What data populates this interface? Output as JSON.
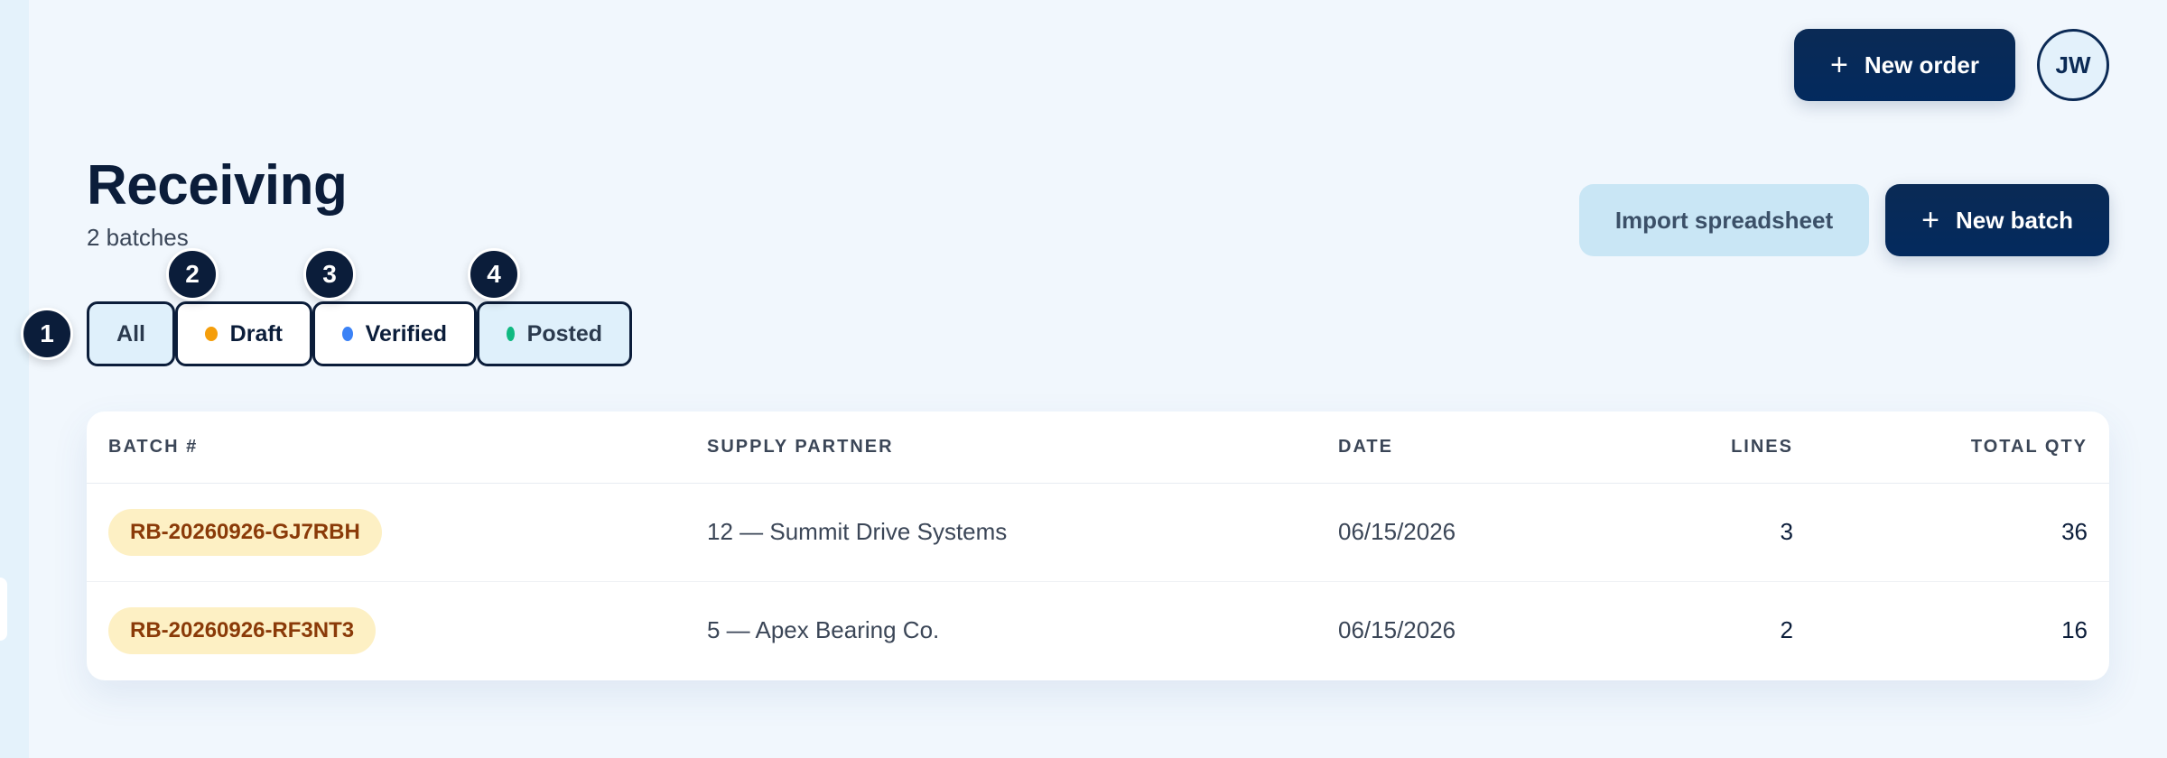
{
  "topbar": {
    "new_order_label": "New order",
    "avatar_initials": "JW"
  },
  "page": {
    "title": "Receiving",
    "subtitle": "2 batches"
  },
  "actions": {
    "import_label": "Import spreadsheet",
    "new_batch_label": "New batch"
  },
  "filters": [
    {
      "label": "All",
      "badge": "1"
    },
    {
      "label": "Draft",
      "badge": "2",
      "dot_color": "#f59e0b"
    },
    {
      "label": "Verified",
      "badge": "3",
      "dot_color": "#3b82f6"
    },
    {
      "label": "Posted",
      "badge": "4",
      "dot_color": "#10b981"
    }
  ],
  "table": {
    "headers": [
      "BATCH #",
      "SUPPLY PARTNER",
      "DATE",
      "LINES",
      "TOTAL QTY"
    ],
    "rows": [
      {
        "batch": "RB-20260926-GJ7RBH",
        "partner": "12 — Summit Drive Systems",
        "date": "06/15/2026",
        "lines": "3",
        "qty": "36"
      },
      {
        "batch": "RB-20260926-RF3NT3",
        "partner": "5 — Apex Bearing Co.",
        "date": "06/15/2026",
        "lines": "2",
        "qty": "16"
      }
    ]
  },
  "colors": {
    "primary": "#062a5a",
    "light_button": "#c9e6f5",
    "batch_pill": "#fdf0c4"
  }
}
